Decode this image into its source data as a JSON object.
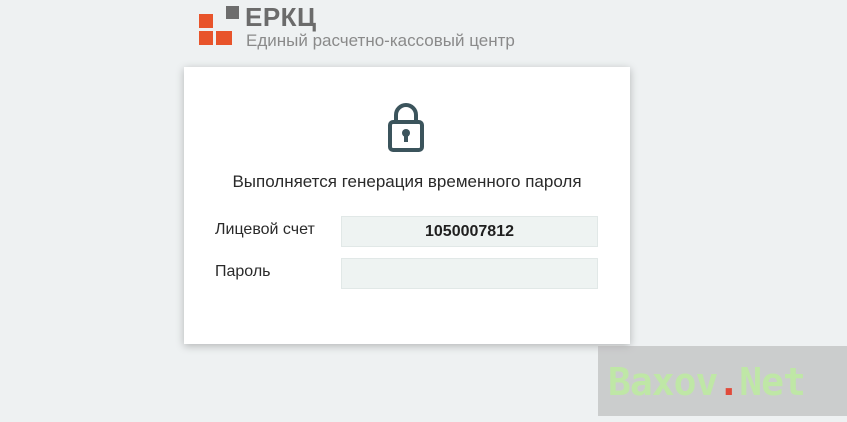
{
  "brand": {
    "title": "ЕРКЦ",
    "subtitle": "Единый расчетно-кассовый центр",
    "colors": {
      "accent": "#e8542b",
      "gray": "#6d6d6d"
    }
  },
  "card": {
    "icon": "lock-icon",
    "heading": "Выполняется генерация временного пароля",
    "fields": [
      {
        "label": "Лицевой счет",
        "value": "1050007812"
      },
      {
        "label": "Пароль",
        "value": ""
      }
    ]
  },
  "watermark": {
    "text_part1": "Baxov",
    "text_dot": ".",
    "text_part2": "Net"
  }
}
